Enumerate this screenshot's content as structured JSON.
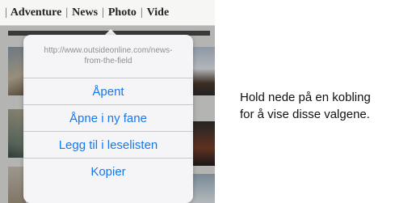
{
  "site_nav": {
    "items": [
      "Adventure",
      "News",
      "Photo",
      "Vide"
    ]
  },
  "context_menu": {
    "url": "http://www.outsideonline.com/news-from-the-field",
    "items": [
      "Åpent",
      "Åpne i ny fane",
      "Legg til i leselisten",
      "Kopier"
    ]
  },
  "caption": {
    "line1": "Hold nede på en kobling",
    "line2": "for å vise disse valgene."
  },
  "colors": {
    "action_blue": "#1478f0",
    "url_gray": "#8e8e93"
  }
}
